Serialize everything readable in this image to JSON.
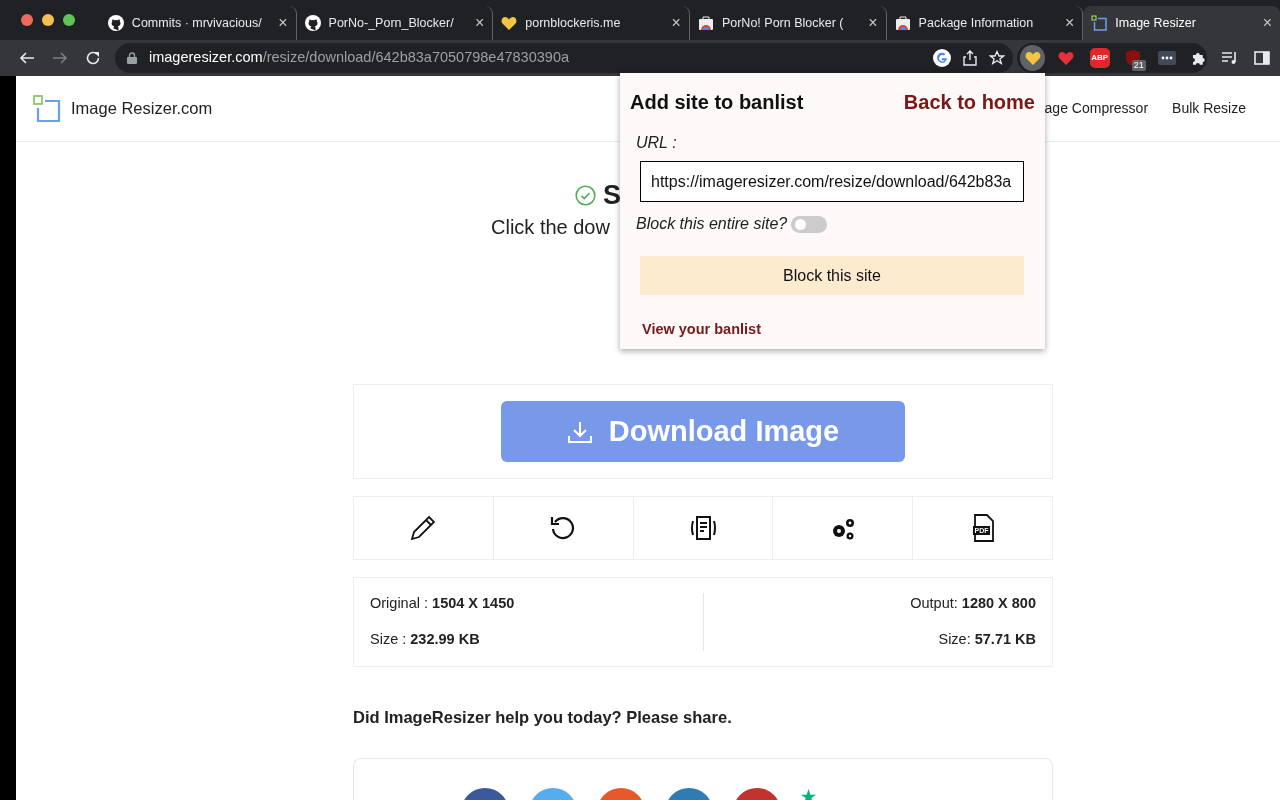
{
  "browser": {
    "tabs": [
      {
        "kind": "github",
        "title": "Commits · mrvivacious/",
        "close": "×",
        "selected": false
      },
      {
        "kind": "github",
        "title": "PorNo-_Porn_Blocker/",
        "close": "×",
        "selected": false
      },
      {
        "kind": "heart",
        "title": "pornblockeris.me",
        "close": "×",
        "selected": false
      },
      {
        "kind": "store",
        "title": "PorNo! Porn Blocker (",
        "close": "×",
        "selected": false
      },
      {
        "kind": "store",
        "title": "Package Information",
        "close": "×",
        "selected": false
      },
      {
        "kind": "resizer",
        "title": "Image Resizer",
        "close": "×",
        "selected": true
      }
    ],
    "address": {
      "host": "imageresizer.com",
      "path": "/resize/download/642b83a7050798e47830390a"
    },
    "extensions": [
      {
        "kind": "heart",
        "color": "#f5c443",
        "active": true
      },
      {
        "kind": "heart",
        "color": "#e3323b",
        "active": false
      },
      {
        "kind": "abp",
        "label": "ABP",
        "active": false
      },
      {
        "kind": "shield",
        "badge": "21",
        "active": false
      },
      {
        "kind": "dots",
        "active": false
      }
    ]
  },
  "site": {
    "brand": "Image Resizer.com",
    "nav": [
      "age Compressor",
      "Bulk Resize"
    ],
    "title": "S",
    "subtitle": "Click the dow",
    "download_button": "Download Image",
    "tools": [
      {
        "kind": "edit"
      },
      {
        "kind": "rotate"
      },
      {
        "kind": "compress"
      },
      {
        "kind": "settings"
      },
      {
        "kind": "pdf",
        "label": "PDF"
      }
    ],
    "info": {
      "left": [
        "Original : **1504 X 1450**",
        "Size : **232.99 KB**"
      ],
      "right": [
        "Output: **1280 X 800**",
        "Size: **57.71 KB**"
      ]
    },
    "share_heading": "Did ImageResizer help you today? Please share.",
    "share": [
      {
        "kind": "circle",
        "color": "#3b5998"
      },
      {
        "kind": "circle",
        "color": "#55acee"
      },
      {
        "kind": "circle",
        "color": "#e9582b"
      },
      {
        "kind": "circle",
        "color": "#2f7cb2"
      },
      {
        "kind": "circle",
        "color": "#c1332f"
      },
      {
        "kind": "trustpilot"
      }
    ]
  },
  "popup": {
    "title": "Add site to banlist",
    "back_link": "Back to home",
    "url_label": "URL :",
    "url_value": "https://imageresizer.com/resize/download/642b83a",
    "toggle_label": "Block this entire site?",
    "toggle_on": false,
    "block_button": "Block this site",
    "banlist_link": "View your banlist"
  }
}
